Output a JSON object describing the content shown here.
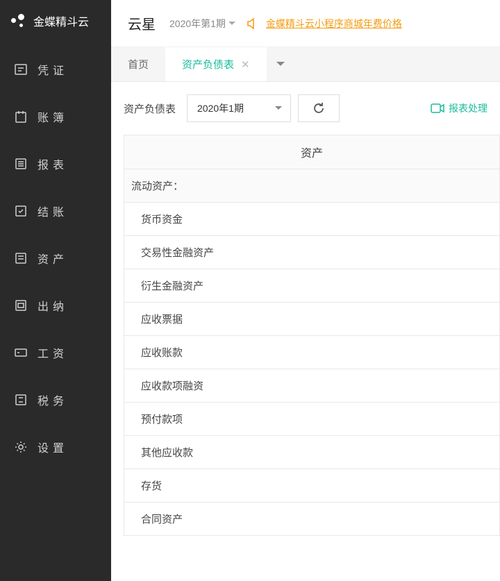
{
  "brand": "金蝶精斗云",
  "sidebar": {
    "items": [
      {
        "label": "凭证"
      },
      {
        "label": "账簿"
      },
      {
        "label": "报表"
      },
      {
        "label": "结账"
      },
      {
        "label": "资产"
      },
      {
        "label": "出纳"
      },
      {
        "label": "工资"
      },
      {
        "label": "税务"
      },
      {
        "label": "设置"
      }
    ]
  },
  "topbar": {
    "company": "云星",
    "period": "2020年第1期",
    "promo_link": "金蝶精斗云小程序商城年费价格"
  },
  "tabs": {
    "home": "首页",
    "active": "资产负债表"
  },
  "toolbar": {
    "label": "资产负债表",
    "period_select": "2020年1期",
    "report_proc": "报表处理"
  },
  "table": {
    "header": "资产",
    "section": "流动资产：",
    "rows": [
      "货币资金",
      "交易性金融资产",
      "衍生金融资产",
      "应收票据",
      "应收账款",
      "应收款项融资",
      "预付款项",
      "其他应收款",
      "存货",
      "合同资产"
    ]
  }
}
